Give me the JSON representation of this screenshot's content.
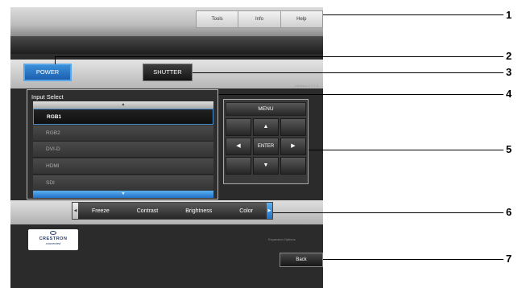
{
  "tools_bar": {
    "tools": "Tools",
    "info": "Info",
    "help": "Help"
  },
  "power_label": "POWER",
  "shutter_label": "SHUTTER",
  "interface_version": "Interface 2.7.2.8",
  "input_select": {
    "title": "Input Select",
    "scroll_up": "▲",
    "scroll_down": "▼",
    "items": [
      "RGB1",
      "RGB2",
      "DVI-D",
      "HDMI",
      "SDI"
    ],
    "selected": "RGB1"
  },
  "menu_pad": {
    "menu": "MENU",
    "up": "▲",
    "down": "▼",
    "left": "◀",
    "right": "▶",
    "enter": "ENTER"
  },
  "image_adjust": {
    "items": [
      "Freeze",
      "Contrast",
      "Brightness",
      "Color"
    ],
    "left_arrow": "◀",
    "right_arrow": "▶"
  },
  "crestron": {
    "logo": "CRESTRON",
    "sub": "connected"
  },
  "expansion_options": "Expansion Options",
  "back_label": "Back",
  "callouts": [
    "1",
    "2",
    "3",
    "4",
    "5",
    "6",
    "7"
  ],
  "colors": {
    "accent": "#2372c8",
    "panel_bg": "#2b2b2b",
    "band": "#c8c8c8"
  }
}
